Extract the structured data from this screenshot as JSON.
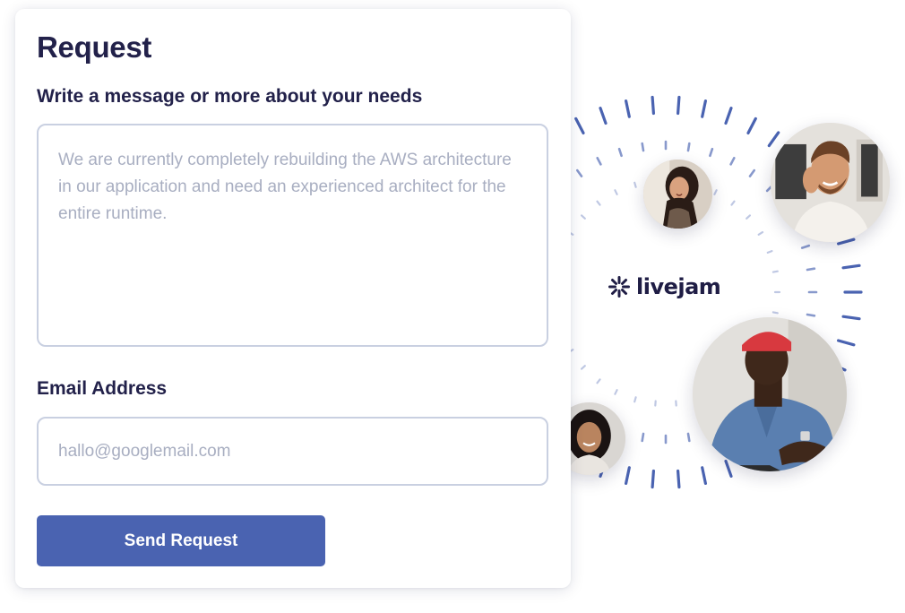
{
  "colors": {
    "accent": "#4a63b1",
    "text_primary": "#22214a",
    "placeholder": "#a8aec1",
    "field_border": "#c9d0e1",
    "ring_dash": "#4a63b1"
  },
  "request_form": {
    "title": "Request",
    "message": {
      "label": "Write a message or more about your needs",
      "placeholder": "We are currently completely rebuilding the AWS architecture in our application and need an experienced architect for the entire runtime.",
      "value": ""
    },
    "email": {
      "label": "Email Address",
      "placeholder": "hallo@googlemail.com",
      "value": ""
    },
    "submit_label": "Send Request"
  },
  "network_graphic": {
    "brand": {
      "name": "livejam",
      "icon": "livejam-star-logo-icon"
    },
    "avatars": [
      {
        "icon": "avatar-woman-smiling"
      },
      {
        "icon": "avatar-man-on-phone"
      },
      {
        "icon": "avatar-man-red-cap"
      },
      {
        "icon": "avatar-woman-dark-hair"
      }
    ]
  }
}
